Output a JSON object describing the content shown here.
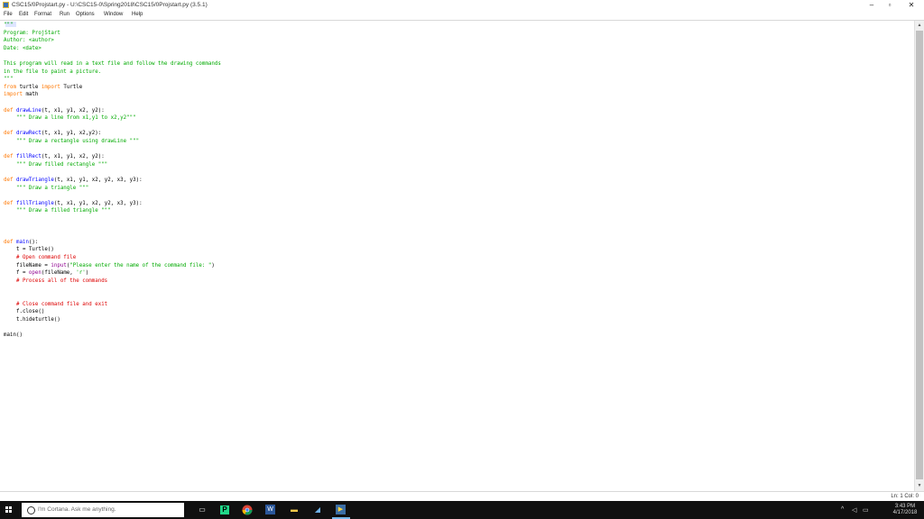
{
  "window": {
    "title": "CSC15/0Projstart.py - U:\\CSC15-0\\Spring2018\\CSC15/0Projstart.py (3.5.1)",
    "minimize_label": "–",
    "maximize_label": "▫",
    "close_label": "✕"
  },
  "menubar": {
    "items": [
      "File",
      "Edit",
      "Format",
      "Run",
      "Options",
      "Window",
      "Help"
    ]
  },
  "editor": {
    "lines": [
      [
        {
          "t": "\"\"\"",
          "c": "string"
        }
      ],
      [
        {
          "t": "Program: ProjStart",
          "c": "string"
        }
      ],
      [
        {
          "t": "Author: <author>",
          "c": "string"
        }
      ],
      [
        {
          "t": "Date: <date>",
          "c": "string"
        }
      ],
      [
        {
          "t": "",
          "c": "plain"
        }
      ],
      [
        {
          "t": "This program will read in a text file and follow the drawing commands",
          "c": "string"
        }
      ],
      [
        {
          "t": "in the file to paint a picture.",
          "c": "string"
        }
      ],
      [
        {
          "t": "\"\"\"",
          "c": "string"
        }
      ],
      [
        {
          "t": "from",
          "c": "keyword"
        },
        {
          "t": " turtle ",
          "c": "plain"
        },
        {
          "t": "import",
          "c": "keyword"
        },
        {
          "t": " Turtle",
          "c": "plain"
        }
      ],
      [
        {
          "t": "import",
          "c": "keyword"
        },
        {
          "t": " math",
          "c": "plain"
        }
      ],
      [
        {
          "t": "",
          "c": "plain"
        }
      ],
      [
        {
          "t": "def",
          "c": "keyword"
        },
        {
          "t": " drawLine",
          "c": "def"
        },
        {
          "t": "(t, x1, y1, x2, y2):",
          "c": "plain"
        }
      ],
      [
        {
          "t": "    \"\"\" Draw a line from x1,y1 to x2,y2\"\"\"",
          "c": "string"
        }
      ],
      [
        {
          "t": "",
          "c": "plain"
        }
      ],
      [
        {
          "t": "def",
          "c": "keyword"
        },
        {
          "t": " drawRect",
          "c": "def"
        },
        {
          "t": "(t, x1, y1, x2,y2):",
          "c": "plain"
        }
      ],
      [
        {
          "t": "    \"\"\" Draw a rectangle using drawLine \"\"\"",
          "c": "string"
        }
      ],
      [
        {
          "t": "",
          "c": "plain"
        }
      ],
      [
        {
          "t": "def",
          "c": "keyword"
        },
        {
          "t": " fillRect",
          "c": "def"
        },
        {
          "t": "(t, x1, y1, x2, y2):",
          "c": "plain"
        }
      ],
      [
        {
          "t": "    \"\"\" Draw filled rectangle \"\"\"",
          "c": "string"
        }
      ],
      [
        {
          "t": "",
          "c": "plain"
        }
      ],
      [
        {
          "t": "def",
          "c": "keyword"
        },
        {
          "t": " drawTriangle",
          "c": "def"
        },
        {
          "t": "(t, x1, y1, x2, y2, x3, y3):",
          "c": "plain"
        }
      ],
      [
        {
          "t": "    \"\"\" Draw a triangle \"\"\"",
          "c": "string"
        }
      ],
      [
        {
          "t": "",
          "c": "plain"
        }
      ],
      [
        {
          "t": "def",
          "c": "keyword"
        },
        {
          "t": " fillTriangle",
          "c": "def"
        },
        {
          "t": "(t, x1, y1, x2, y2, x3, y3):",
          "c": "plain"
        }
      ],
      [
        {
          "t": "    \"\"\" Draw a filled triangle \"\"\"",
          "c": "string"
        }
      ],
      [
        {
          "t": "",
          "c": "plain"
        }
      ],
      [
        {
          "t": "",
          "c": "plain"
        }
      ],
      [
        {
          "t": "",
          "c": "plain"
        }
      ],
      [
        {
          "t": "def",
          "c": "keyword"
        },
        {
          "t": " main",
          "c": "def"
        },
        {
          "t": "():",
          "c": "plain"
        }
      ],
      [
        {
          "t": "    t = Turtle()",
          "c": "plain"
        }
      ],
      [
        {
          "t": "    # Open command file",
          "c": "comment"
        }
      ],
      [
        {
          "t": "    fileName = ",
          "c": "plain"
        },
        {
          "t": "input",
          "c": "builtin"
        },
        {
          "t": "(",
          "c": "plain"
        },
        {
          "t": "\"Please enter the name of the command file: \"",
          "c": "string"
        },
        {
          "t": ")",
          "c": "plain"
        }
      ],
      [
        {
          "t": "    f = ",
          "c": "plain"
        },
        {
          "t": "open",
          "c": "builtin"
        },
        {
          "t": "(fileName, ",
          "c": "plain"
        },
        {
          "t": "'r'",
          "c": "string"
        },
        {
          "t": ")",
          "c": "plain"
        }
      ],
      [
        {
          "t": "    # Process all of the commands",
          "c": "comment"
        }
      ],
      [
        {
          "t": "",
          "c": "plain"
        }
      ],
      [
        {
          "t": "",
          "c": "plain"
        }
      ],
      [
        {
          "t": "    # Close command file and exit",
          "c": "comment"
        }
      ],
      [
        {
          "t": "    f.close()",
          "c": "plain"
        }
      ],
      [
        {
          "t": "    t.hideturtle()",
          "c": "plain"
        }
      ],
      [
        {
          "t": "",
          "c": "plain"
        }
      ],
      [
        {
          "t": "main()",
          "c": "plain"
        }
      ]
    ]
  },
  "statusbar": {
    "position": "Ln: 1   Col: 0"
  },
  "taskbar": {
    "search_placeholder": "I'm Cortana. Ask me anything.",
    "icons": [
      "task-view-icon",
      "pycharm-icon",
      "chrome-icon",
      "word-icon",
      "file-explorer-icon",
      "notes-icon",
      "idle-python-icon"
    ],
    "clock_time": "3:43 PM",
    "clock_date": "4/17/2018"
  },
  "colors": {
    "string": "#00aa00",
    "keyword": "#ff7700",
    "def": "#0000ff",
    "comment": "#dd0000",
    "builtin": "#900090",
    "taskbar": "#101010"
  }
}
